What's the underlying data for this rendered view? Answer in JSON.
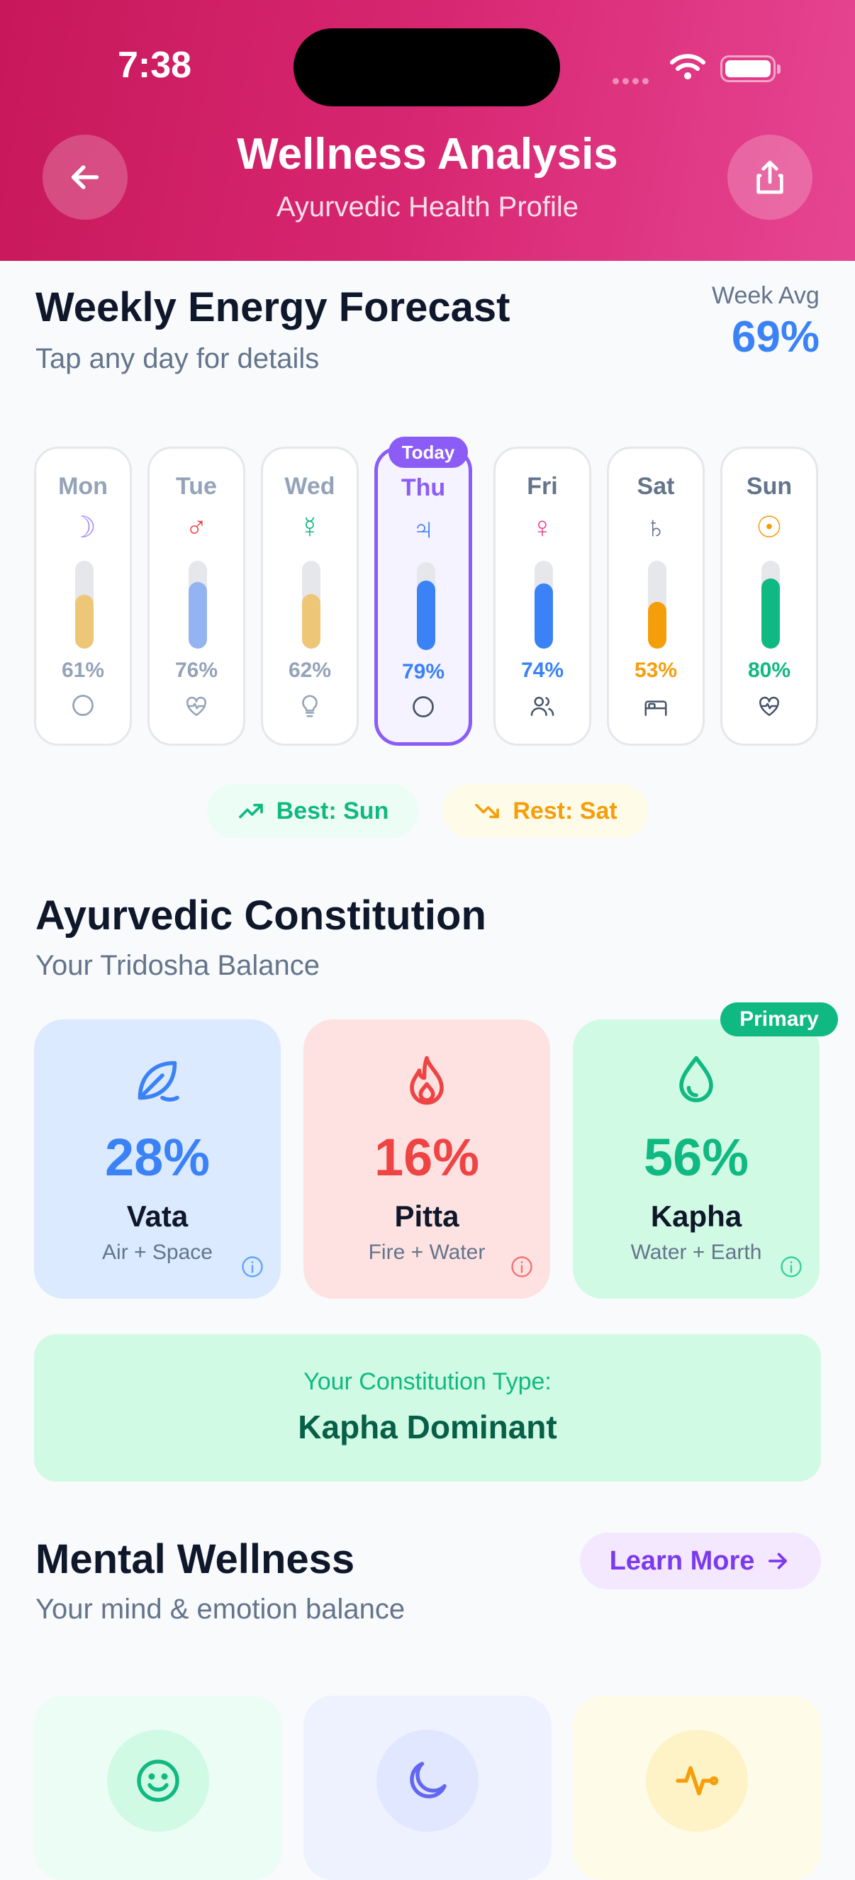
{
  "status_bar": {
    "time": "7:38"
  },
  "header": {
    "title": "Wellness Analysis",
    "subtitle": "Ayurvedic Health Profile"
  },
  "forecast": {
    "title": "Weekly Energy Forecast",
    "subtitle": "Tap any day for details",
    "week_avg_label": "Week Avg",
    "week_avg_value": "69%",
    "today_badge": "Today",
    "days": [
      {
        "name": "Mon",
        "planet": "☽",
        "pct": "61%",
        "level": 0.61,
        "icon": "circle-icon"
      },
      {
        "name": "Tue",
        "planet": "♂",
        "pct": "76%",
        "level": 0.76,
        "icon": "heart-pulse-icon"
      },
      {
        "name": "Wed",
        "planet": "☿",
        "pct": "62%",
        "level": 0.62,
        "icon": "lightbulb-icon"
      },
      {
        "name": "Thu",
        "planet": "♃",
        "pct": "79%",
        "level": 0.79,
        "icon": "circle-icon"
      },
      {
        "name": "Fri",
        "planet": "♀",
        "pct": "74%",
        "level": 0.74,
        "icon": "users-icon"
      },
      {
        "name": "Sat",
        "planet": "♄",
        "pct": "53%",
        "level": 0.53,
        "icon": "bed-icon"
      },
      {
        "name": "Sun",
        "planet": "☉",
        "pct": "80%",
        "level": 0.8,
        "icon": "heart-pulse-icon"
      }
    ],
    "best": "Best: Sun",
    "rest": "Rest: Sat"
  },
  "constitution": {
    "title": "Ayurvedic Constitution",
    "subtitle": "Your Tridosha Balance",
    "primary_badge": "Primary",
    "doshas": [
      {
        "pct": "28%",
        "name": "Vata",
        "elements": "Air + Space",
        "color": "#3b82f6",
        "bg": "#dbeafe"
      },
      {
        "pct": "16%",
        "name": "Pitta",
        "elements": "Fire + Water",
        "color": "#ef4444",
        "bg": "#fee2e2"
      },
      {
        "pct": "56%",
        "name": "Kapha",
        "elements": "Water + Earth",
        "color": "#10b981",
        "bg": "#d1fae5"
      }
    ],
    "type_label": "Your Constitution Type:",
    "type_value": "Kapha Dominant"
  },
  "mental": {
    "title": "Mental Wellness",
    "subtitle": "Your mind & emotion balance",
    "learn_more": "Learn More"
  }
}
